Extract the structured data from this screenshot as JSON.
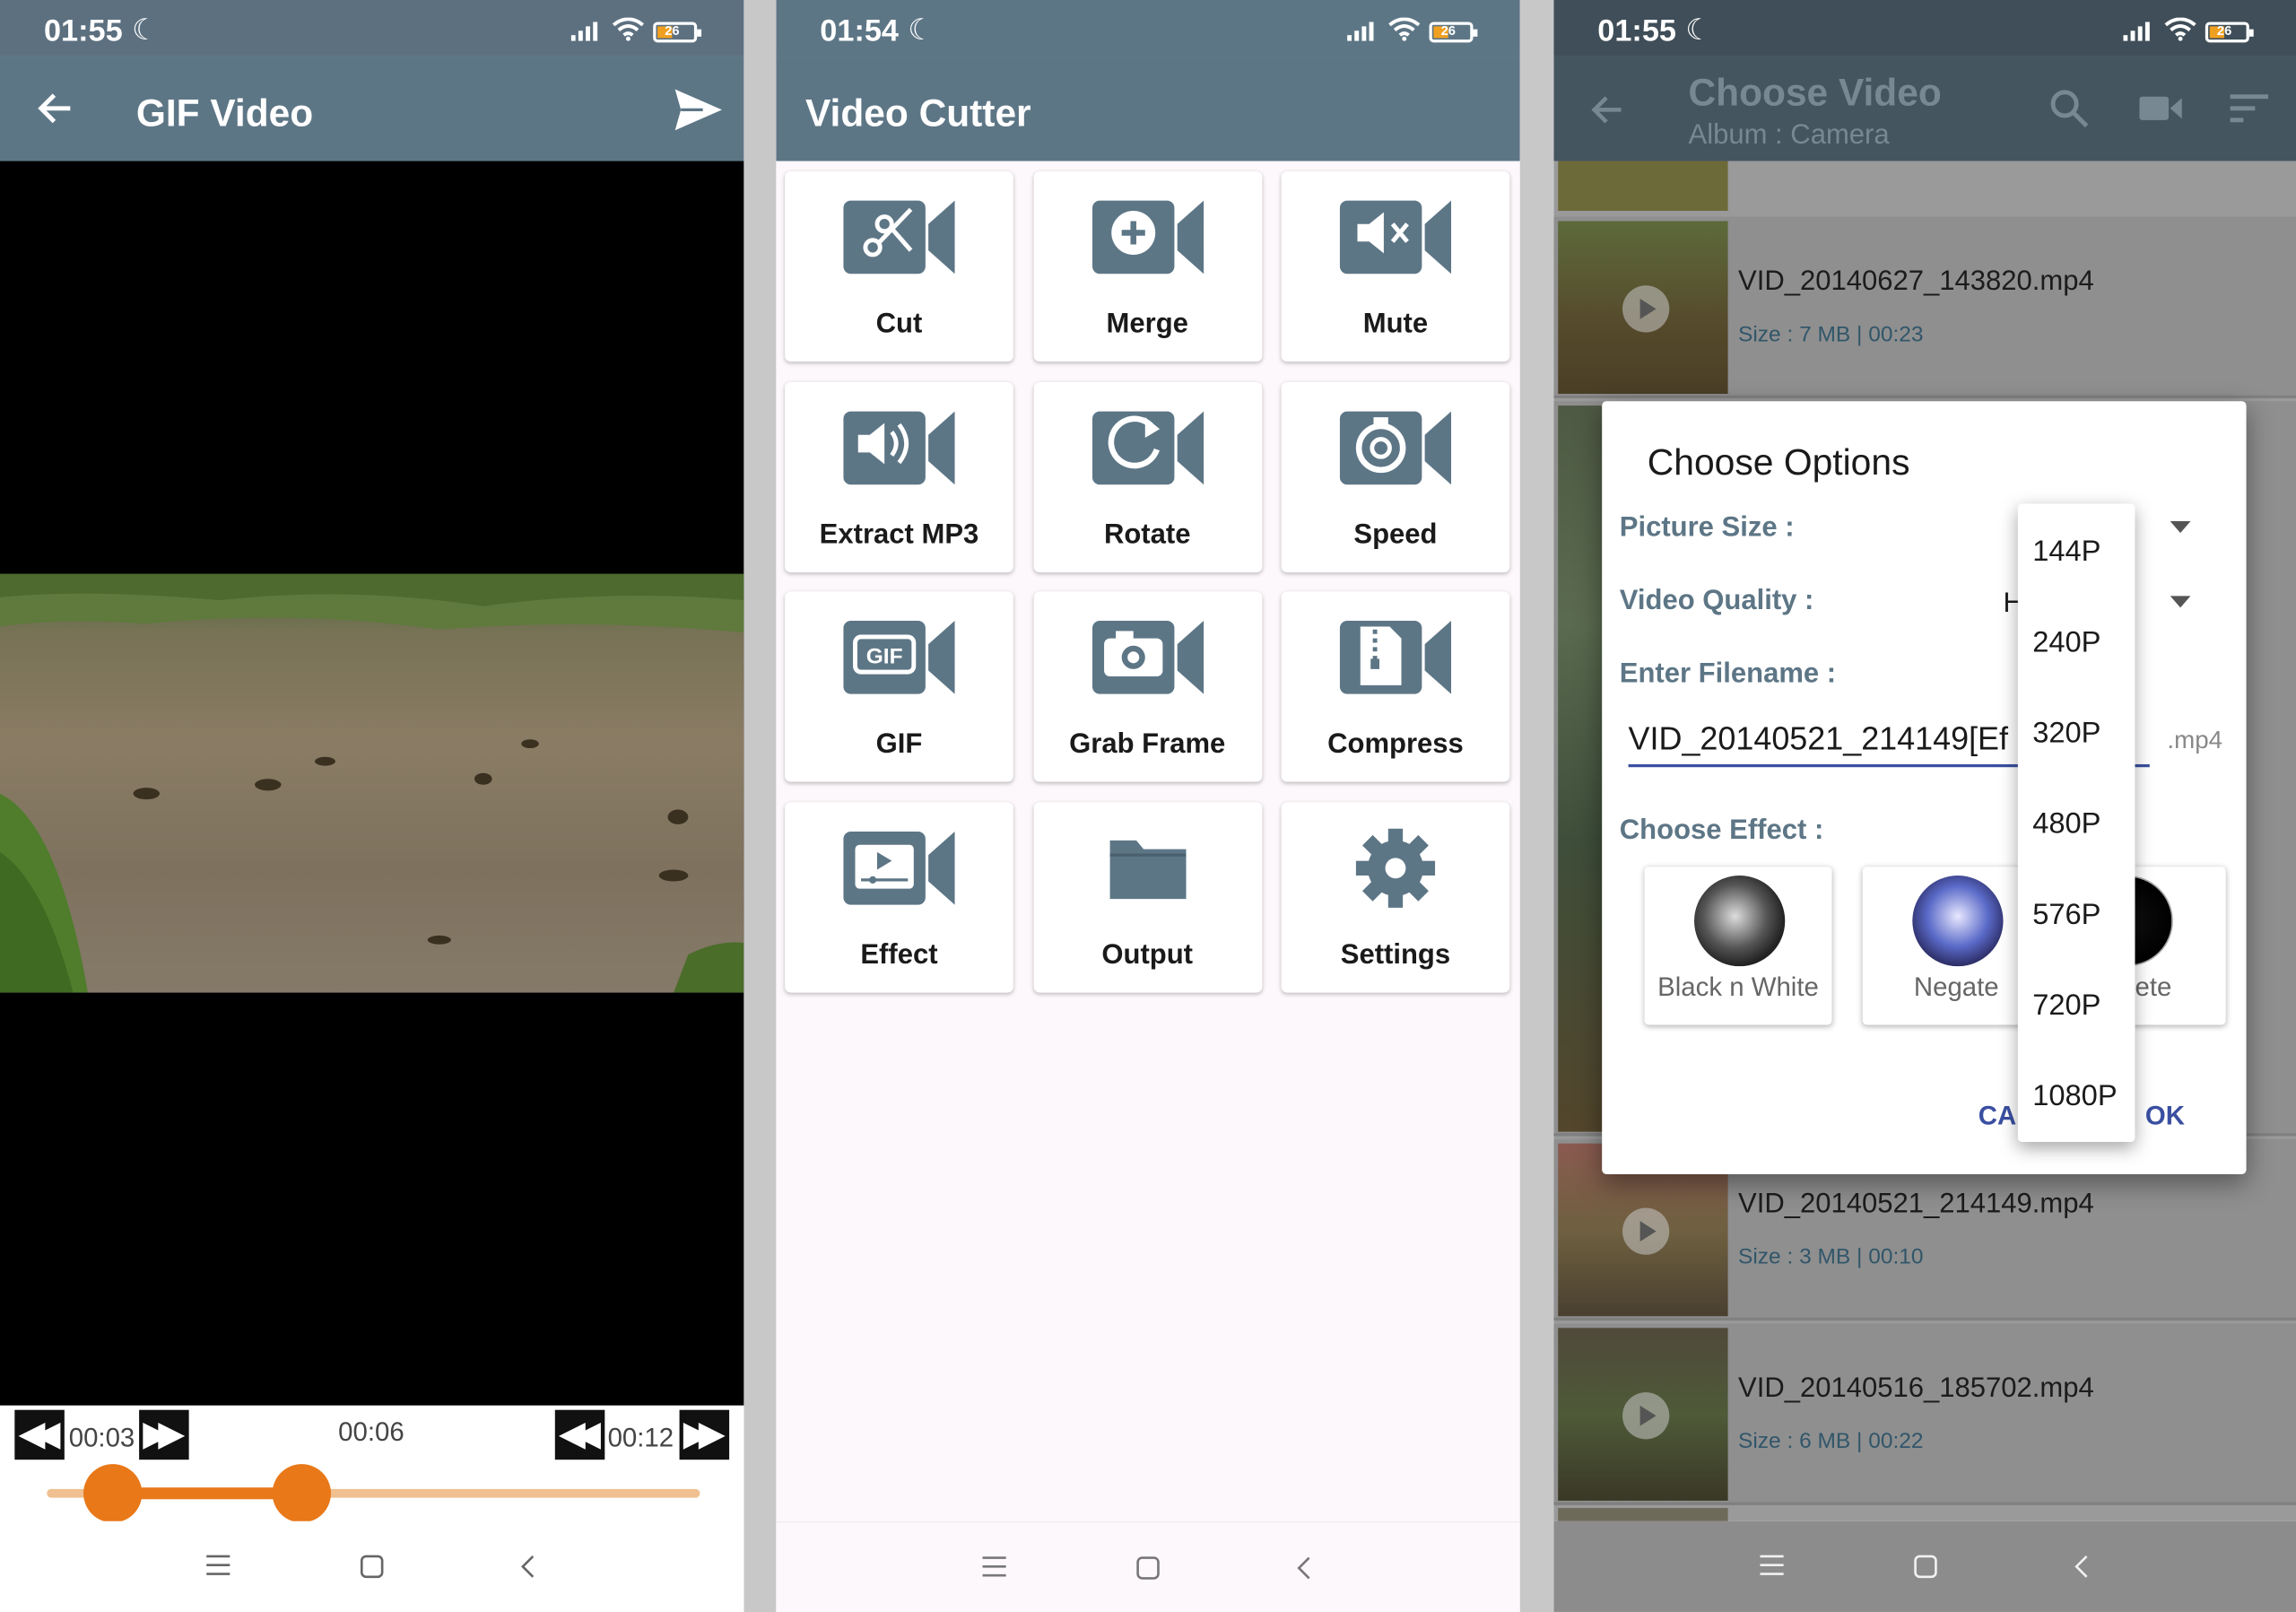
{
  "gif_screen": {
    "status": {
      "time": "01:55",
      "battery": "26"
    },
    "title": "GIF Video",
    "start_time": "00:03",
    "middle_time": "00:06",
    "end_time": "00:12",
    "rewind_label": "◀◀",
    "forward_label": "▶▶",
    "selection": {
      "start_fraction": 0.1,
      "end_fraction": 0.39
    }
  },
  "menu_screen": {
    "status": {
      "time": "01:54",
      "battery": "26"
    },
    "title": "Video Cutter",
    "tiles": [
      {
        "label": "Cut",
        "icon": "scissors-icon"
      },
      {
        "label": "Merge",
        "icon": "plus-icon"
      },
      {
        "label": "Mute",
        "icon": "mute-icon"
      },
      {
        "label": "Extract MP3",
        "icon": "speaker-icon"
      },
      {
        "label": "Rotate",
        "icon": "rotate-icon"
      },
      {
        "label": "Speed",
        "icon": "stopwatch-icon"
      },
      {
        "label": "GIF",
        "icon": "gif-icon"
      },
      {
        "label": "Grab Frame",
        "icon": "camera-icon"
      },
      {
        "label": "Compress",
        "icon": "zip-file-icon"
      },
      {
        "label": "Effect",
        "icon": "video-player-icon"
      },
      {
        "label": "Output",
        "icon": "folder-icon"
      },
      {
        "label": "Settings",
        "icon": "gear-icon"
      }
    ]
  },
  "choose_screen": {
    "status": {
      "time": "01:55",
      "battery": "26"
    },
    "title": "Choose Video",
    "subtitle": "Album : Camera",
    "videos": [
      {
        "name": "VID_20140627_143820.mp4",
        "size": "Size : 7 MB | 00:23"
      },
      {
        "name": "VID_20140521_214149.mp4",
        "size": "Size : 3 MB | 00:10"
      },
      {
        "name": "VID_20140516_185702.mp4",
        "size": "Size : 6 MB | 00:22"
      }
    ],
    "dialog": {
      "title": "Choose Options",
      "picture_size_label": "Picture Size :",
      "video_quality_label": "Video Quality :",
      "video_quality_value": "H",
      "filename_label": "Enter Filename :",
      "filename_value": "VID_20140521_214149[Ef",
      "extension": ".mp4",
      "effect_label": "Choose Effect :",
      "effects": [
        "Black n White",
        "Negate",
        "ge Dete"
      ],
      "cancel": "CAI",
      "ok": "OK"
    },
    "resolutions": [
      "144P",
      "240P",
      "320P",
      "480P",
      "576P",
      "720P",
      "1080P"
    ]
  },
  "colors": {
    "toolbar": "#5d7686",
    "accent": "#e87818",
    "icon": "#5d7686",
    "link": "#3a4fa0"
  }
}
